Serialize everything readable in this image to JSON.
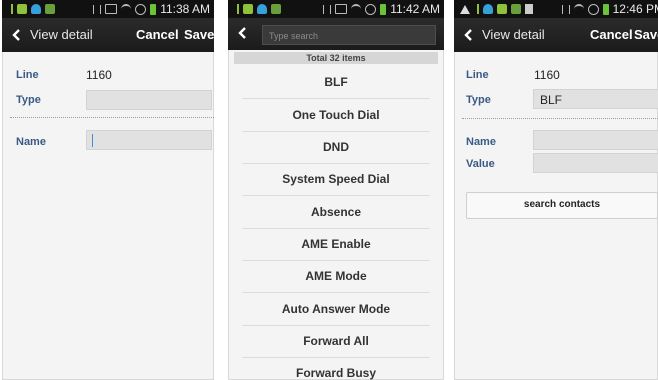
{
  "screen1": {
    "time": "11:38 AM",
    "back_label": "View detail",
    "cancel_label": "Cancel",
    "save_label": "Save",
    "line_label": "Line",
    "line_value": "1160",
    "type_label": "Type",
    "type_value": "",
    "name_label": "Name",
    "name_value": ""
  },
  "screen2": {
    "time": "11:42 AM",
    "search_placeholder": "Type search",
    "total_label": "Total 32 items",
    "items": [
      "BLF",
      "One Touch Dial",
      "DND",
      "System Speed Dial",
      "Absence",
      "AME Enable",
      "AME Mode",
      "Auto Answer Mode",
      "Forward All",
      "Forward Busy"
    ]
  },
  "screen3": {
    "time": "12:46 PM",
    "back_label": "View detail",
    "cancel_label": "Cancel",
    "save_label": "Save",
    "line_label": "Line",
    "line_value": "1160",
    "type_label": "Type",
    "type_value": "BLF",
    "name_label": "Name",
    "value_label": "Value",
    "search_contacts_label": "search contacts"
  },
  "colors": {
    "label_blue": "#3a5a86",
    "action_bar": "#1b1b1b",
    "field_bg": "#e1e1e1"
  }
}
